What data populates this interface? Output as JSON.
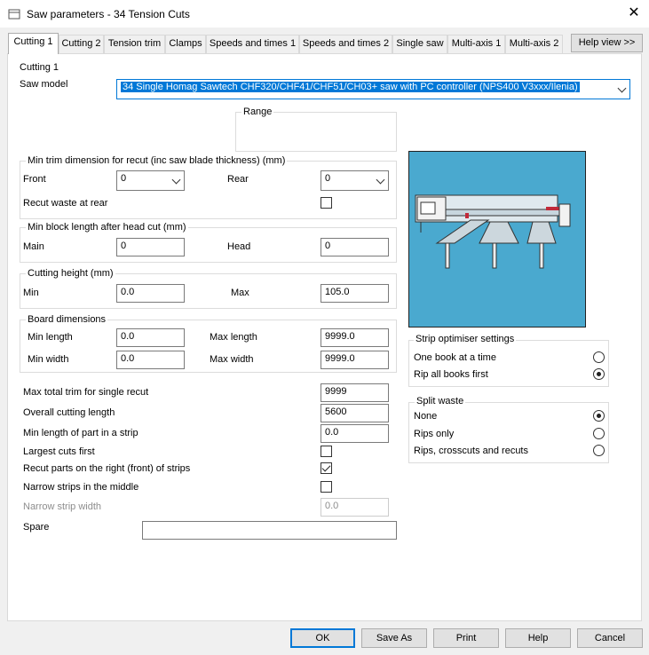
{
  "window": {
    "title": "Saw parameters - 34 Tension Cuts",
    "close_symbol": "✕"
  },
  "tabs": [
    {
      "label": "Cutting 1"
    },
    {
      "label": "Cutting 2"
    },
    {
      "label": "Tension trim"
    },
    {
      "label": "Clamps"
    },
    {
      "label": "Speeds and times 1"
    },
    {
      "label": "Speeds and times 2"
    },
    {
      "label": "Single saw"
    },
    {
      "label": "Multi-axis 1"
    },
    {
      "label": "Multi-axis 2"
    }
  ],
  "help_view_label": "Help view >>",
  "section_title": "Cutting 1",
  "saw_model": {
    "label": "Saw model",
    "value": "34 Single Homag Sawtech CHF320/CHF41/CHF51/CH03+ saw with PC controller (NPS400 V3xxx/Ilenia)"
  },
  "range_label": "Range",
  "min_trim": {
    "title": "Min trim dimension for recut (inc saw blade thickness) (mm)",
    "front_label": "Front",
    "front_value": "0",
    "rear_label": "Rear",
    "rear_value": "0",
    "recut_waste_label": "Recut waste at rear",
    "recut_waste_checked": false
  },
  "min_block": {
    "title": "Min block length after head cut (mm)",
    "main_label": "Main",
    "main_value": "0",
    "head_label": "Head",
    "head_value": "0"
  },
  "cutting_height": {
    "title": "Cutting height (mm)",
    "min_label": "Min",
    "min_value": "0.0",
    "max_label": "Max",
    "max_value": "105.0"
  },
  "board": {
    "title": "Board dimensions",
    "min_length_label": "Min length",
    "min_length_value": "0.0",
    "max_length_label": "Max length",
    "max_length_value": "9999.0",
    "min_width_label": "Min width",
    "min_width_value": "0.0",
    "max_width_label": "Max width",
    "max_width_value": "9999.0"
  },
  "misc": {
    "max_total_trim_label": "Max total trim for single recut",
    "max_total_trim_value": "9999",
    "overall_length_label": "Overall cutting length",
    "overall_length_value": "5600",
    "min_part_label": "Min length of part in a strip",
    "min_part_value": "0.0",
    "largest_cuts_label": "Largest cuts first",
    "largest_cuts_checked": false,
    "recut_right_label": "Recut parts on the right (front) of strips",
    "recut_right_checked": true,
    "narrow_middle_label": "Narrow strips in the middle",
    "narrow_middle_checked": false,
    "narrow_width_label": "Narrow strip width",
    "narrow_width_value": "0.0",
    "spare_label": "Spare",
    "spare_value": ""
  },
  "strip_optimiser": {
    "title": "Strip optimiser settings",
    "options": [
      "One book at a time",
      "Rip all books first"
    ],
    "selected": 1
  },
  "split_waste": {
    "title": "Split waste",
    "options": [
      "None",
      "Rips only",
      "Rips, crosscuts and recuts"
    ],
    "selected": 0
  },
  "buttons": {
    "ok": "OK",
    "save_as": "Save As",
    "print": "Print",
    "help": "Help",
    "cancel": "Cancel"
  },
  "colors": {
    "accent": "#0078d7",
    "illustration_bg": "#4aa9cf"
  }
}
